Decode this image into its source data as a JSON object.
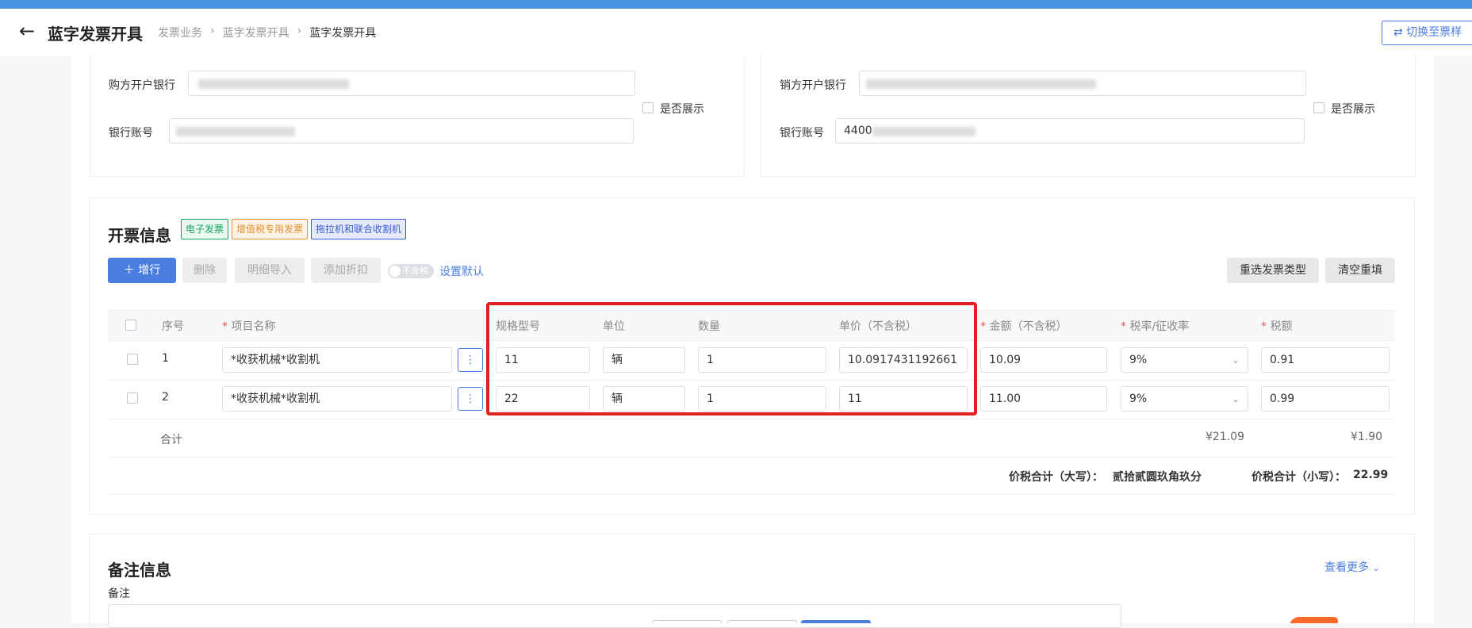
{
  "header": {
    "back_icon": "arrow-left-icon",
    "title": "蓝字发票开具",
    "breadcrumb": [
      "发票业务",
      "蓝字发票开具",
      "蓝字发票开具"
    ],
    "switch_label": "⇄  切换至票样"
  },
  "bank_section": {
    "buyer_bank_label": "购方开户银行",
    "buyer_account_label": "银行账号",
    "seller_bank_label": "销方开户银行",
    "seller_account_label": "银行账号",
    "seller_account_value": "4400",
    "show_label": "是否展示"
  },
  "invoice_section": {
    "title": "开票信息",
    "tags": [
      "电子发票",
      "增值税专用发票",
      "拖拉机和联合收割机"
    ],
    "add_row": "＋  增行",
    "delete": "删除",
    "import": "明细导入",
    "discount": "添加折扣",
    "toggle_label": "不含税",
    "set_default": "设置默认",
    "reselect": "重选发票类型",
    "clear": "清空重填",
    "columns": {
      "seq": "序号",
      "name": "项目名称",
      "spec": "规格型号",
      "unit": "单位",
      "qty": "数量",
      "price": "单价（不含税）",
      "amount": "金额（不含税）",
      "rate": "税率/征收率",
      "tax": "税额"
    },
    "rows": [
      {
        "seq": "1",
        "name": "*收获机械*收割机",
        "spec": "11",
        "unit": "辆",
        "qty": "1",
        "price": "10.0917431192661",
        "amount": "10.09",
        "rate": "9%",
        "tax": "0.91"
      },
      {
        "seq": "2",
        "name": "*收获机械*收割机",
        "spec": "22",
        "unit": "辆",
        "qty": "1",
        "price": "11",
        "amount": "11.00",
        "rate": "9%",
        "tax": "0.99"
      }
    ],
    "total_label": "合计",
    "total_amount": "¥21.09",
    "total_tax": "¥1.90",
    "sum_upper_label": "价税合计（大写）：",
    "sum_upper_value": "贰拾贰圆玖角玖分",
    "sum_lower_label": "价税合计（小写）：",
    "sum_lower_value": "22.99"
  },
  "remark_section": {
    "title": "备注信息",
    "more": "查看更多",
    "remark_label": "备注"
  },
  "colors": {
    "primary": "#4a7de0",
    "highlight_box": "#e02020"
  }
}
